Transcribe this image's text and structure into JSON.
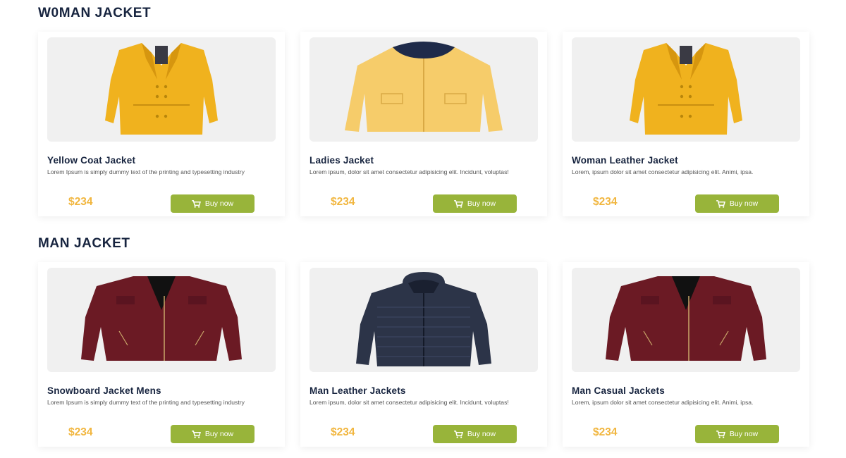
{
  "sections": [
    {
      "title": "W0MAN JACKET",
      "products": [
        {
          "name": "Yellow Coat Jacket",
          "desc": "Lorem Ipsum is simply dummy text of the printing and typesetting industry",
          "price": "$234",
          "button": "Buy now",
          "image": "yellow-coat-jacket"
        },
        {
          "name": "Ladies Jacket",
          "desc": "Lorem ipsum, dolor sit amet consectetur adipisicing elit. Incidunt, voluptas!",
          "price": "$234",
          "button": "Buy now",
          "image": "ladies-jacket"
        },
        {
          "name": "Woman Leather Jacket",
          "desc": "Lorem, ipsum dolor sit amet consectetur adipisicing elit. Animi, ipsa.",
          "price": "$234",
          "button": "Buy now",
          "image": "yellow-coat-jacket"
        }
      ]
    },
    {
      "title": "MAN JACKET",
      "products": [
        {
          "name": "Snowboard Jacket Mens",
          "desc": "Lorem Ipsum is simply dummy text of the printing and typesetting industry",
          "price": "$234",
          "button": "Buy now",
          "image": "maroon-leather-jacket"
        },
        {
          "name": "Man Leather Jackets",
          "desc": "Lorem ipsum, dolor sit amet consectetur adipisicing elit. Incidunt, voluptas!",
          "price": "$234",
          "button": "Buy now",
          "image": "navy-puffer-jacket"
        },
        {
          "name": "Man Casual Jackets",
          "desc": "Lorem, ipsum dolor sit amet consectetur adipisicing elit. Animi, ipsa.",
          "price": "$234",
          "button": "Buy now",
          "image": "maroon-leather-jacket"
        }
      ]
    }
  ],
  "icons": {
    "buy_button": "cart-icon"
  },
  "colors": {
    "price": "#f1b63f",
    "button": "#98b43a",
    "heading": "#17243f"
  }
}
